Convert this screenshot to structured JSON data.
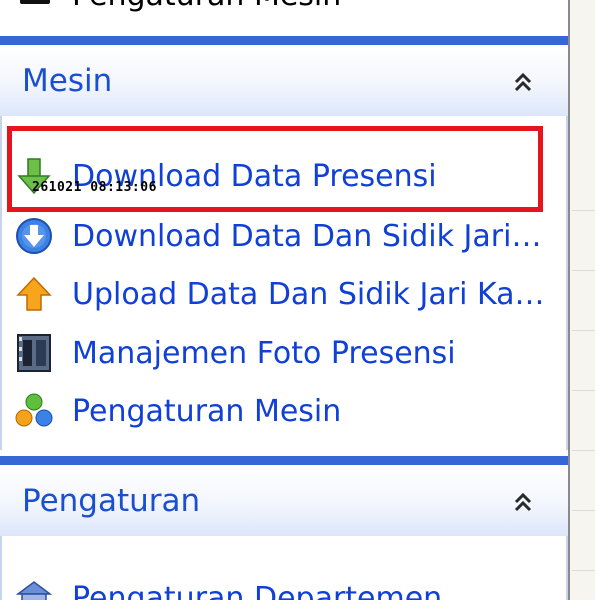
{
  "top_cut": {
    "label": "Pengaturan Mesin"
  },
  "sections": {
    "mesin": {
      "title": "Mesin",
      "items": [
        {
          "label": "Download Data Presensi",
          "icon": "green-down-arrow-icon"
        },
        {
          "label": "Download Data Dan Sidik Jari K...",
          "icon": "blue-down-circle-icon"
        },
        {
          "label": "Upload Data Dan Sidik Jari Kary...",
          "icon": "orange-up-arrow-icon"
        },
        {
          "label": "Manajemen Foto Presensi",
          "icon": "photo-film-icon"
        },
        {
          "label": "Pengaturan Mesin",
          "icon": "colored-balls-icon"
        }
      ]
    },
    "pengaturan": {
      "title": "Pengaturan",
      "items": [
        {
          "label": "Pengaturan Departemen",
          "icon": "department-icon"
        }
      ]
    }
  },
  "overlay": {
    "timestamp": "261021 08:13:06"
  },
  "colors": {
    "accent": "#3568d4",
    "link": "#1140d6",
    "highlight": "#e5141f"
  }
}
